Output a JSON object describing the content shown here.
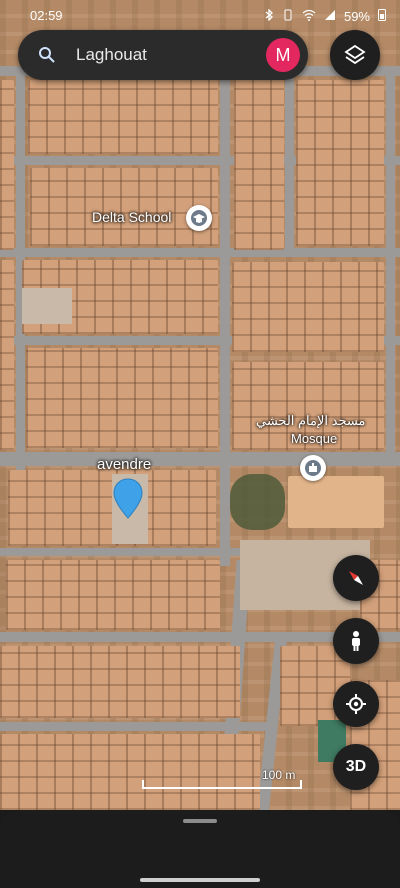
{
  "status_bar": {
    "time": "02:59",
    "battery": "59%",
    "icons": [
      "bluetooth-icon",
      "vibrate-icon",
      "wifi-icon",
      "signal-icon",
      "battery-icon"
    ]
  },
  "search": {
    "query": "Laghouat",
    "avatar_letter": "M",
    "avatar_color": "#e2285f"
  },
  "map_labels": {
    "school": "Delta School",
    "mosque_arabic": "مسجد الإمام الحشي",
    "mosque": "Mosque",
    "pin_label": "avendre"
  },
  "pin_color": "#3fa1e8",
  "scale": {
    "label": "100 m"
  },
  "controls": {
    "layers": "layers-icon",
    "compass": "compass-icon",
    "street_view": "pegman-icon",
    "location": "my-location-icon",
    "three_d": "3D"
  }
}
